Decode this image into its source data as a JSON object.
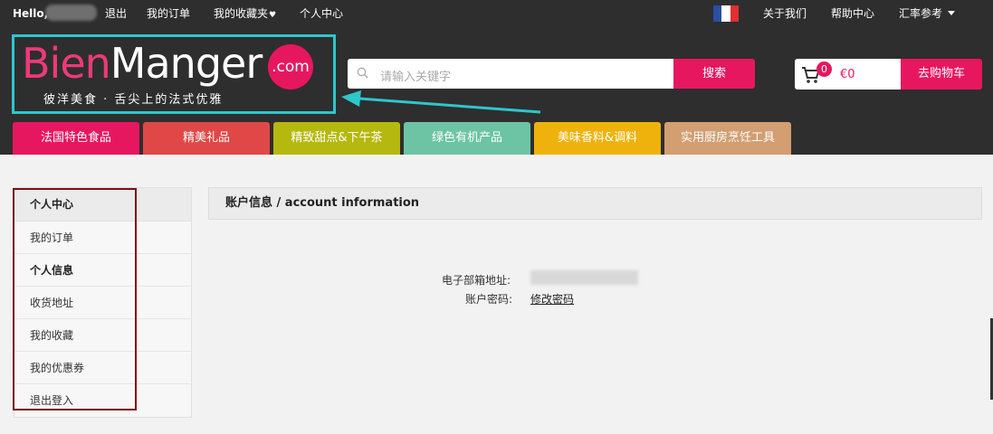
{
  "topbar": {
    "hello": "Hello,",
    "logout": "退出",
    "my_orders": "我的订单",
    "favorites": "我的收藏夹",
    "account_center": "个人中心",
    "about_us": "关于我们",
    "help": "帮助中心",
    "exchange": "汇率参考"
  },
  "logo": {
    "bien": "Bien",
    "manger": "Manger",
    "com": ".com",
    "tagline": "彼洋美食 · 舌尖上的法式优雅"
  },
  "search": {
    "placeholder": "请输入关键字",
    "button": "搜索"
  },
  "cart": {
    "count": "0",
    "amount": "€0",
    "checkout": "去购物车"
  },
  "categories": [
    {
      "label": "法国特色食品",
      "color": "#e7175f"
    },
    {
      "label": "精美礼品",
      "color": "#e04848"
    },
    {
      "label": "精致甜点&下午茶",
      "color": "#b5b80e"
    },
    {
      "label": "绿色有机产品",
      "color": "#6cc4a4"
    },
    {
      "label": "美味香料&调料",
      "color": "#eeb20c"
    },
    {
      "label": "实用厨房烹饪工具",
      "color": "#d29e72"
    }
  ],
  "sidebar": {
    "title": "个人中心",
    "items": [
      {
        "label": "我的订单"
      },
      {
        "label": "个人信息"
      },
      {
        "label": "收货地址"
      },
      {
        "label": "我的收藏"
      },
      {
        "label": "我的优惠券"
      },
      {
        "label": "退出登入"
      }
    ]
  },
  "main": {
    "title": "账户信息 / account information",
    "email_label": "电子部箱地址:",
    "password_label": "账户密码:",
    "change_password": "修改密码"
  },
  "colors": {
    "brand_pink": "#e7175f",
    "dark_bar": "#2e2e2e",
    "highlight_cyan": "#2dc7cc",
    "outline_red": "#7a1010"
  }
}
